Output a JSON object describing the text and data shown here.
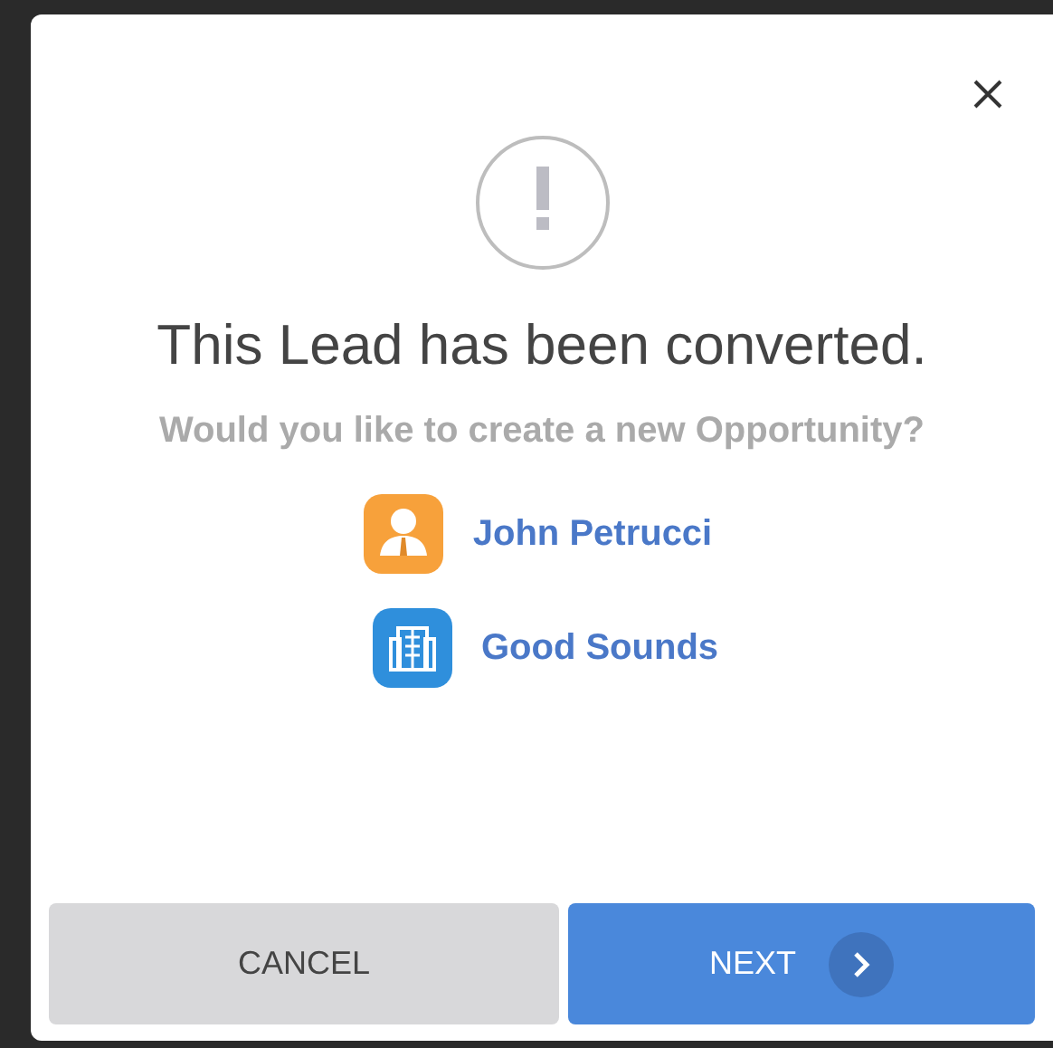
{
  "dialog": {
    "title": "This Lead has been converted.",
    "message": "Would you like to create a new Opportunity?",
    "records": [
      {
        "kind": "contact",
        "label": "John Petrucci",
        "color": "#f7a13b"
      },
      {
        "kind": "account",
        "label": "Good Sounds",
        "color": "#2f8fdc"
      }
    ],
    "buttons": [
      {
        "kind": "cancel",
        "label": "CANCEL"
      },
      {
        "kind": "next",
        "label": "NEXT"
      }
    ]
  }
}
